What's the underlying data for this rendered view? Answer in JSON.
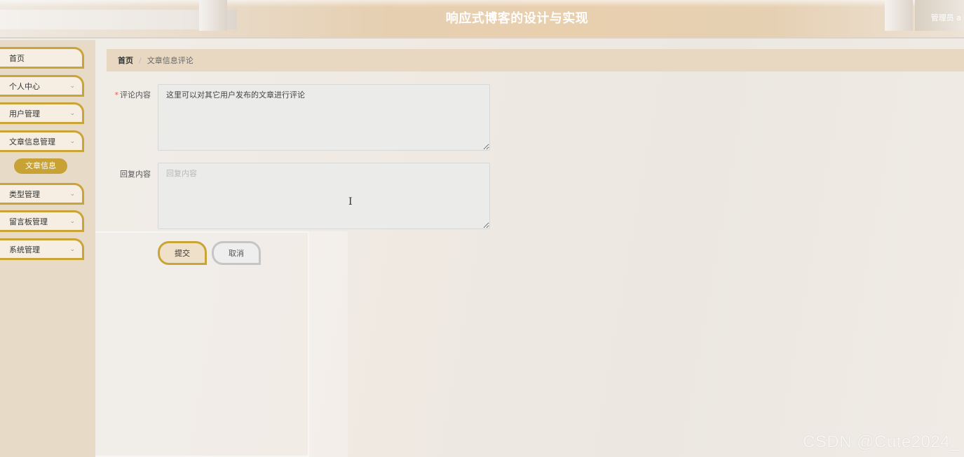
{
  "header": {
    "title": "响应式博客的设计与实现",
    "user_label": "管理员 a"
  },
  "sidebar": {
    "items": [
      {
        "label": "首页",
        "has_submenu": false
      },
      {
        "label": "个人中心",
        "has_submenu": true
      },
      {
        "label": "用户管理",
        "has_submenu": true
      },
      {
        "label": "文章信息管理",
        "has_submenu": true,
        "expanded": true
      },
      {
        "label": "类型管理",
        "has_submenu": true
      },
      {
        "label": "留言板管理",
        "has_submenu": true
      },
      {
        "label": "系统管理",
        "has_submenu": true
      }
    ],
    "active_subitem": {
      "label": "文章信息"
    }
  },
  "breadcrumb": {
    "home": "首页",
    "separator": "/",
    "current": "文章信息评论"
  },
  "form": {
    "comment": {
      "label": "评论内容",
      "required_mark": "*",
      "value": "这里可以对其它用户发布的文章进行评论"
    },
    "reply": {
      "label": "回复内容",
      "placeholder": "回复内容",
      "value": ""
    },
    "submit_label": "提交",
    "cancel_label": "取消"
  },
  "watermark": "CSDN @Cute2024_",
  "colors": {
    "accent_gold": "#c9a437",
    "sidebar_bg": "#e7dac7",
    "breadcrumb_bg": "#e8d8c2",
    "required_star": "#e15757"
  },
  "icons": {
    "chevron": "chevron-down-icon",
    "text_cursor": "text-cursor-icon"
  }
}
